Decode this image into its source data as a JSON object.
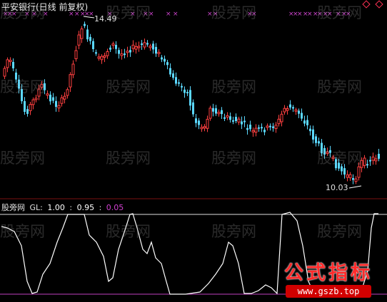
{
  "window": {
    "title": "平安银行(日线 前复权)",
    "colors": {
      "background": "#000000",
      "up": "#ff4040",
      "down": "#5bd8ff",
      "marker": "#cc44cc",
      "gl_line": "#ffffff"
    }
  },
  "price_panel": {
    "high_label": "14.49",
    "low_label": "10.03"
  },
  "indicator_panel": {
    "name": "股旁网",
    "param_label": "GL:",
    "v1": "1.00",
    "sep": ":",
    "v2": "0.95",
    "sep2": ":",
    "v3": "0.05"
  },
  "watermark": {
    "text": "股旁网"
  },
  "logo": {
    "main": "公式指标",
    "url": "www.gszb.top"
  },
  "chart_data": [
    {
      "type": "candlestick",
      "title": "平安银行(日线 前复权)",
      "annotations": [
        "14.49",
        "10.03"
      ],
      "y_high": 14.49,
      "y_low": 10.03
    },
    {
      "type": "line",
      "series": [
        {
          "name": "GL"
        }
      ],
      "levels": [
        1.0,
        0.95,
        0.05
      ]
    }
  ]
}
